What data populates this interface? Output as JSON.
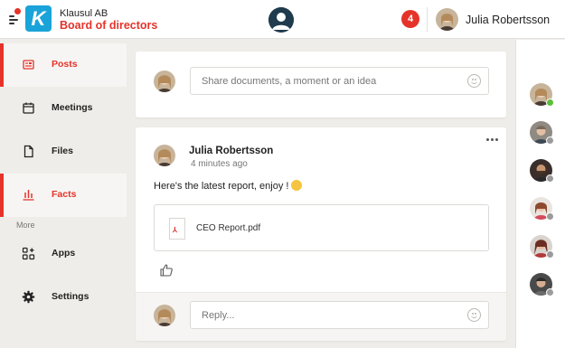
{
  "header": {
    "org_name": "Klausul AB",
    "workspace_name": "Board of directors",
    "logo_letter": "K",
    "notification_count": "4",
    "user_name": "Julia Robertsson",
    "colors": {
      "accent": "#e5332a",
      "logo": "#1aa3d9"
    }
  },
  "sidebar": {
    "items": [
      {
        "label": "Posts",
        "icon": "posts-icon",
        "active": true
      },
      {
        "label": "Meetings",
        "icon": "calendar-icon",
        "active": false
      },
      {
        "label": "Files",
        "icon": "file-icon",
        "active": false
      },
      {
        "label": "Facts",
        "icon": "bar-chart-icon",
        "active": false
      }
    ],
    "section_more": "More",
    "more_items": [
      {
        "label": "Apps",
        "icon": "apps-icon"
      },
      {
        "label": "Settings",
        "icon": "gear-icon"
      }
    ]
  },
  "composer": {
    "placeholder": "Share documents, a moment or an idea"
  },
  "post": {
    "author": "Julia Robertsson",
    "time": "4 minutes ago",
    "text": "Here's the latest report, enjoy !",
    "attachment": {
      "name": "CEO Report.pdf",
      "icon": "pdf-icon"
    },
    "reply_placeholder": "Reply..."
  },
  "contacts": [
    {
      "icon": "avatar-icon",
      "status": "online",
      "status_color": "#5bbf3a"
    },
    {
      "icon": "avatar-icon",
      "status": "offline",
      "status_color": "#9b9b9b"
    },
    {
      "icon": "avatar-icon",
      "status": "offline",
      "status_color": "#9b9b9b"
    },
    {
      "icon": "avatar-icon",
      "status": "offline",
      "status_color": "#9b9b9b"
    },
    {
      "icon": "avatar-icon",
      "status": "offline",
      "status_color": "#9b9b9b"
    },
    {
      "icon": "avatar-icon",
      "status": "offline",
      "status_color": "#9b9b9b"
    }
  ]
}
